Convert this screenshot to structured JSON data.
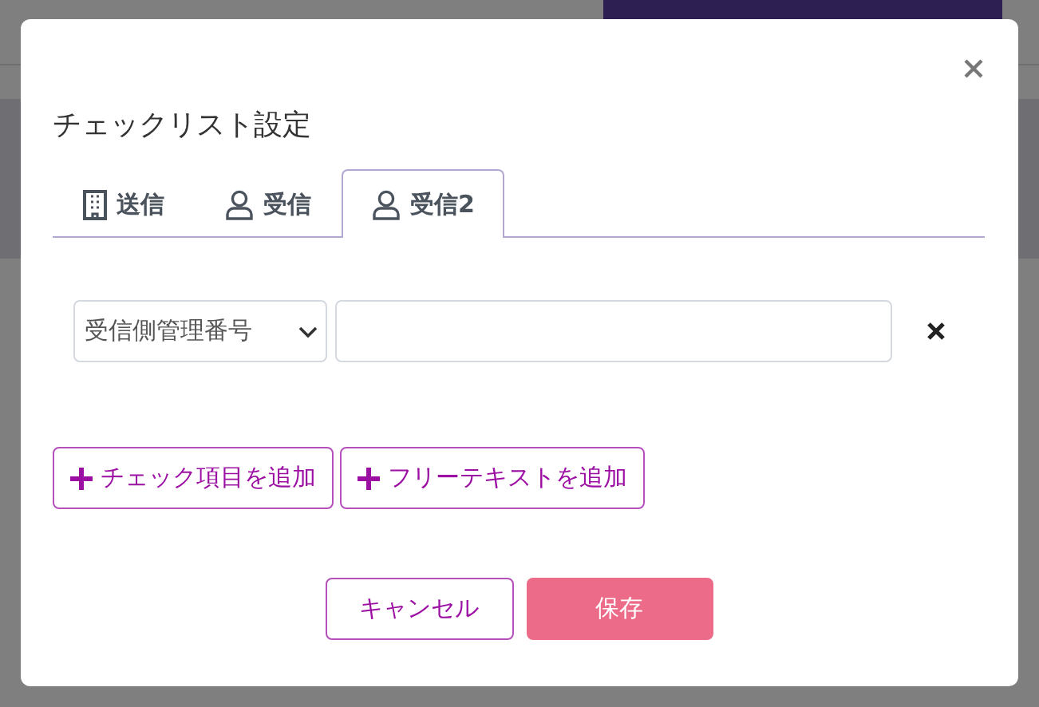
{
  "dialog": {
    "title": "チェックリスト設定",
    "tabs": [
      {
        "label": "送信",
        "kind": "building",
        "selected": false
      },
      {
        "label": "受信",
        "kind": "person",
        "selected": false
      },
      {
        "label": "受信2",
        "kind": "person",
        "selected": true
      }
    ],
    "conditions": [
      {
        "field": "受信側管理番号"
      }
    ],
    "add_buttons": [
      "チェック項目を追加",
      "フリーテキストを追加"
    ],
    "cancel_button": "キャンセル",
    "save_button": "保存"
  }
}
